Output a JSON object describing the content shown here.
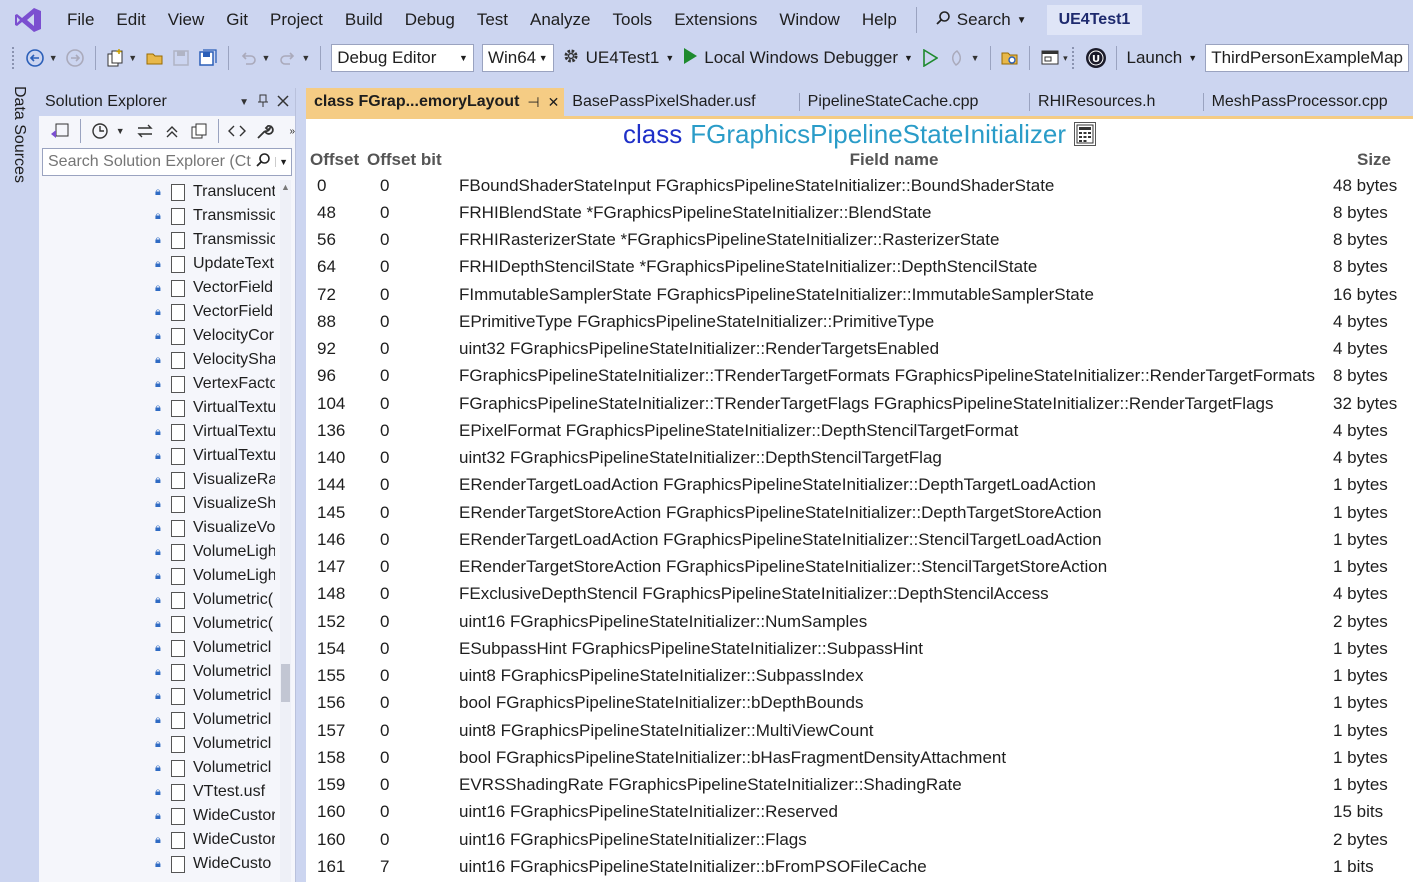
{
  "menubar": {
    "items": [
      "File",
      "Edit",
      "View",
      "Git",
      "Project",
      "Build",
      "Debug",
      "Test",
      "Analyze",
      "Tools",
      "Extensions",
      "Window",
      "Help"
    ],
    "search_label": "Search",
    "solution_name": "UE4Test1"
  },
  "toolbar": {
    "configuration": "Debug Editor",
    "platform": "Win64",
    "startup_project": "UE4Test1",
    "debugger": "Local Windows Debugger",
    "launch_label": "Launch",
    "map_value": "ThirdPersonExampleMap"
  },
  "side_tab": {
    "data_sources": "Data Sources"
  },
  "solution_explorer": {
    "title": "Solution Explorer",
    "search_placeholder": "Search Solution Explorer (Ctr",
    "items": [
      "Translucent",
      "Transmissic",
      "Transmissic",
      "UpdateText",
      "VectorField",
      "VectorField",
      "VelocityCor",
      "VelocitySha",
      "VertexFacto",
      "VirtualTextu",
      "VirtualTextu",
      "VirtualTextu",
      "VisualizeRa",
      "VisualizeSh",
      "VisualizeVo",
      "VolumeLigh",
      "VolumeLigh",
      "Volumetric(",
      "Volumetric(",
      "Volumetricl",
      "Volumetricl",
      "Volumetricl",
      "Volumetricl",
      "Volumetricl",
      "Volumetricl",
      "VTtest.usf",
      "WideCustor",
      "WideCustor",
      "WideCusto"
    ]
  },
  "tabs": [
    {
      "label": "class FGrap...emoryLayout",
      "active": true
    },
    {
      "label": "BasePassPixelShader.usf",
      "active": false
    },
    {
      "label": "PipelineStateCache.cpp",
      "active": false
    },
    {
      "label": "RHIResources.h",
      "active": false
    },
    {
      "label": "MeshPassProcessor.cpp",
      "active": false
    }
  ],
  "layout_view": {
    "class_keyword": "class",
    "class_name": "FGraphicsPipelineStateInitializer",
    "columns": {
      "offset": "Offset",
      "offset_bit": "Offset bit",
      "field": "Field name",
      "size": "Size"
    },
    "rows": [
      {
        "offset": "0",
        "bit": "0",
        "field": "FBoundShaderStateInput FGraphicsPipelineStateInitializer::BoundShaderState",
        "size": "48 bytes"
      },
      {
        "offset": "48",
        "bit": "0",
        "field": "FRHIBlendState *FGraphicsPipelineStateInitializer::BlendState",
        "size": "8 bytes"
      },
      {
        "offset": "56",
        "bit": "0",
        "field": "FRHIRasterizerState *FGraphicsPipelineStateInitializer::RasterizerState",
        "size": "8 bytes"
      },
      {
        "offset": "64",
        "bit": "0",
        "field": "FRHIDepthStencilState *FGraphicsPipelineStateInitializer::DepthStencilState",
        "size": "8 bytes"
      },
      {
        "offset": "72",
        "bit": "0",
        "field": "FImmutableSamplerState FGraphicsPipelineStateInitializer::ImmutableSamplerState",
        "size": "16 bytes"
      },
      {
        "offset": "88",
        "bit": "0",
        "field": "EPrimitiveType FGraphicsPipelineStateInitializer::PrimitiveType",
        "size": "4 bytes"
      },
      {
        "offset": "92",
        "bit": "0",
        "field": "uint32 FGraphicsPipelineStateInitializer::RenderTargetsEnabled",
        "size": "4 bytes"
      },
      {
        "offset": "96",
        "bit": "0",
        "field": "FGraphicsPipelineStateInitializer::TRenderTargetFormats FGraphicsPipelineStateInitializer::RenderTargetFormats",
        "size": "8 bytes"
      },
      {
        "offset": "104",
        "bit": "0",
        "field": "FGraphicsPipelineStateInitializer::TRenderTargetFlags FGraphicsPipelineStateInitializer::RenderTargetFlags",
        "size": "32 bytes"
      },
      {
        "offset": "136",
        "bit": "0",
        "field": "EPixelFormat FGraphicsPipelineStateInitializer::DepthStencilTargetFormat",
        "size": "4 bytes"
      },
      {
        "offset": "140",
        "bit": "0",
        "field": "uint32 FGraphicsPipelineStateInitializer::DepthStencilTargetFlag",
        "size": "4 bytes"
      },
      {
        "offset": "144",
        "bit": "0",
        "field": "ERenderTargetLoadAction FGraphicsPipelineStateInitializer::DepthTargetLoadAction",
        "size": "1 bytes"
      },
      {
        "offset": "145",
        "bit": "0",
        "field": "ERenderTargetStoreAction FGraphicsPipelineStateInitializer::DepthTargetStoreAction",
        "size": "1 bytes"
      },
      {
        "offset": "146",
        "bit": "0",
        "field": "ERenderTargetLoadAction FGraphicsPipelineStateInitializer::StencilTargetLoadAction",
        "size": "1 bytes"
      },
      {
        "offset": "147",
        "bit": "0",
        "field": "ERenderTargetStoreAction FGraphicsPipelineStateInitializer::StencilTargetStoreAction",
        "size": "1 bytes"
      },
      {
        "offset": "148",
        "bit": "0",
        "field": "FExclusiveDepthStencil FGraphicsPipelineStateInitializer::DepthStencilAccess",
        "size": "4 bytes"
      },
      {
        "offset": "152",
        "bit": "0",
        "field": "uint16 FGraphicsPipelineStateInitializer::NumSamples",
        "size": "2 bytes"
      },
      {
        "offset": "154",
        "bit": "0",
        "field": "ESubpassHint FGraphicsPipelineStateInitializer::SubpassHint",
        "size": "1 bytes"
      },
      {
        "offset": "155",
        "bit": "0",
        "field": "uint8 FGraphicsPipelineStateInitializer::SubpassIndex",
        "size": "1 bytes"
      },
      {
        "offset": "156",
        "bit": "0",
        "field": "bool FGraphicsPipelineStateInitializer::bDepthBounds",
        "size": "1 bytes"
      },
      {
        "offset": "157",
        "bit": "0",
        "field": "uint8 FGraphicsPipelineStateInitializer::MultiViewCount",
        "size": "1 bytes"
      },
      {
        "offset": "158",
        "bit": "0",
        "field": "bool FGraphicsPipelineStateInitializer::bHasFragmentDensityAttachment",
        "size": "1 bytes"
      },
      {
        "offset": "159",
        "bit": "0",
        "field": "EVRSShadingRate FGraphicsPipelineStateInitializer::ShadingRate",
        "size": "1 bytes"
      },
      {
        "offset": "160",
        "bit": "0",
        "field": "uint16 FGraphicsPipelineStateInitializer::Reserved",
        "size": "15 bits"
      },
      {
        "offset": "160",
        "bit": "0",
        "field": "uint16 FGraphicsPipelineStateInitializer::Flags",
        "size": "2 bytes"
      },
      {
        "offset": "161",
        "bit": "7",
        "field": "uint16 FGraphicsPipelineStateInitializer::bFromPSOFileCache",
        "size": "1 bits"
      }
    ]
  }
}
